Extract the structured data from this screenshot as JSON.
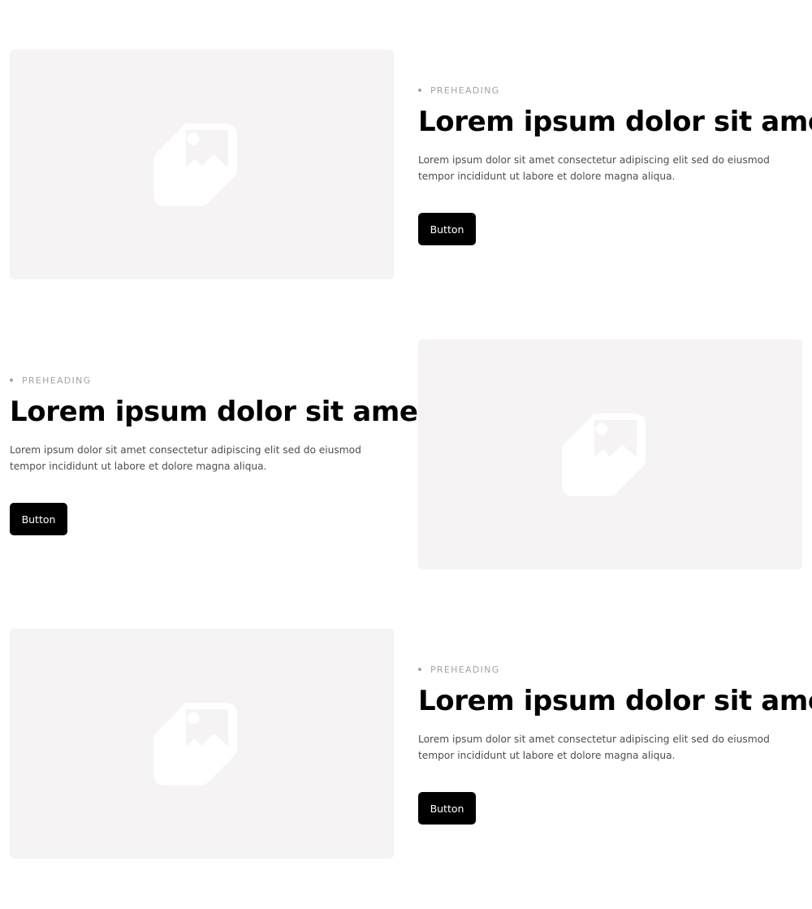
{
  "colors": {
    "image_placeholder_bg": "#f5f3f3",
    "button_bg": "#000000",
    "button_text": "#ffffff",
    "preheading": "#a3a3a3",
    "body_text": "#4d4d4d"
  },
  "sections": [
    {
      "image_icon": "image-placeholder-icon",
      "preheading": "PREHEADING",
      "headline": "Lorem ipsum dolor sit amet",
      "body": "Lorem ipsum dolor sit amet consectetur adipiscing elit sed do eiusmod tempor incididunt ut labore et dolore magna aliqua.",
      "button_label": "Button"
    },
    {
      "image_icon": "image-placeholder-icon",
      "preheading": "PREHEADING",
      "headline": "Lorem ipsum dolor sit amet",
      "body": "Lorem ipsum dolor sit amet consectetur adipiscing elit sed do eiusmod tempor incididunt ut labore et dolore magna aliqua.",
      "button_label": "Button"
    },
    {
      "image_icon": "image-placeholder-icon",
      "preheading": "PREHEADING",
      "headline": "Lorem ipsum dolor sit amet",
      "body": "Lorem ipsum dolor sit amet consectetur adipiscing elit sed do eiusmod tempor incididunt ut labore et dolore magna aliqua.",
      "button_label": "Button"
    }
  ]
}
